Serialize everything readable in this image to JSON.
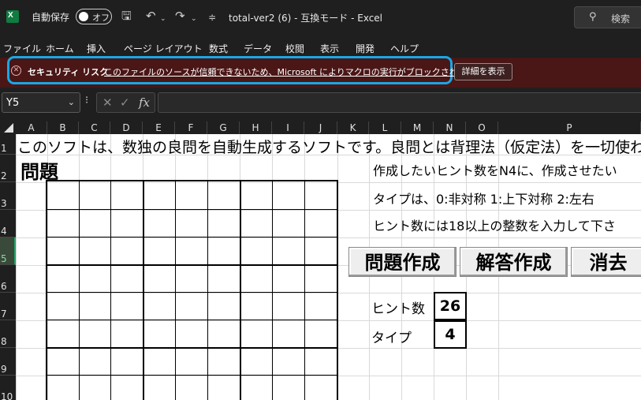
{
  "titlebar": {
    "app_icon_letter": "X",
    "autosave_label": "自動保存",
    "autosave_state": "オフ",
    "doc_title": "total-ver2 (6)  -  互換モード  -  Excel",
    "search_label": "検索"
  },
  "menu": [
    "ファイル",
    "ホーム",
    "挿入",
    "ページ レイアウト",
    "数式",
    "データ",
    "校閲",
    "表示",
    "開発",
    "ヘルプ"
  ],
  "security": {
    "title": "セキュリティ リスク",
    "message": "このファイルのソースが信頼できないため、Microsoft によりマクロの実行がブロックされました。",
    "details_button": "詳細を表示",
    "icon": "blocked-icon",
    "highlight_color": "#17a8e6"
  },
  "formula_bar": {
    "namebox": "Y5",
    "fx_label": "fx",
    "value": ""
  },
  "columns": [
    "A",
    "B",
    "C",
    "D",
    "E",
    "F",
    "G",
    "H",
    "I",
    "J",
    "K",
    "L",
    "M",
    "N",
    "O",
    "P"
  ],
  "rows": [
    "1",
    "2",
    "3",
    "4",
    "5",
    "6",
    "7",
    "8",
    "9",
    "10"
  ],
  "selected_row": "5",
  "sheet": {
    "intro": "このソフトは、数独の良問を自動生成するソフトです。良問とは背理法（仮定法）を一切使わ",
    "mondai": "問題",
    "line1": "作成したいヒント数をN4に、作成させたい",
    "line2": "タイプは、0:非対称  1:上下対称  2:左右",
    "line3": "ヒント数には18以上の整数を入力して下さ",
    "buttons": {
      "create": "問題作成",
      "solve": "解答作成",
      "clear": "消去"
    },
    "hint_label": "ヒント数",
    "hint_value": "26",
    "type_label": "タイプ",
    "type_value": "4"
  }
}
